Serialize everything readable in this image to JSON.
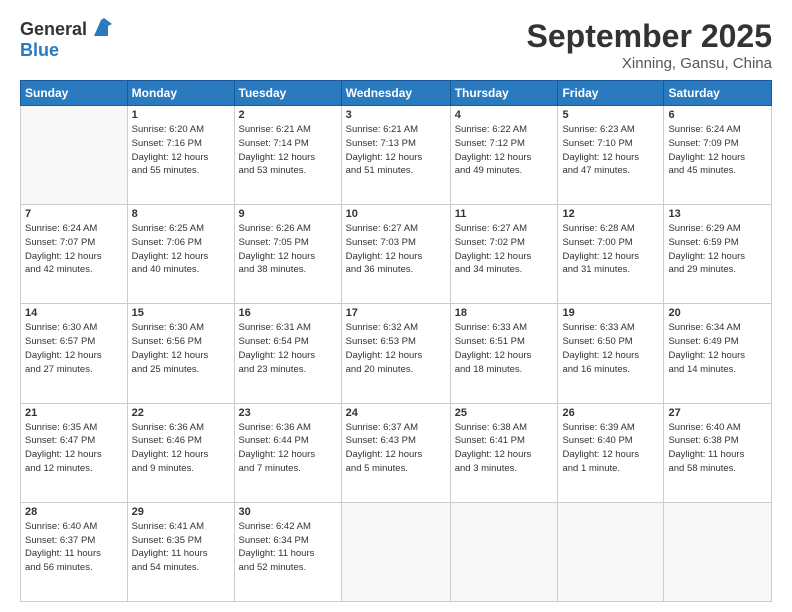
{
  "logo": {
    "general": "General",
    "blue": "Blue"
  },
  "title": "September 2025",
  "subtitle": "Xinning, Gansu, China",
  "header": {
    "days": [
      "Sunday",
      "Monday",
      "Tuesday",
      "Wednesday",
      "Thursday",
      "Friday",
      "Saturday"
    ]
  },
  "weeks": [
    [
      {
        "day": "",
        "info": ""
      },
      {
        "day": "1",
        "info": "Sunrise: 6:20 AM\nSunset: 7:16 PM\nDaylight: 12 hours\nand 55 minutes."
      },
      {
        "day": "2",
        "info": "Sunrise: 6:21 AM\nSunset: 7:14 PM\nDaylight: 12 hours\nand 53 minutes."
      },
      {
        "day": "3",
        "info": "Sunrise: 6:21 AM\nSunset: 7:13 PM\nDaylight: 12 hours\nand 51 minutes."
      },
      {
        "day": "4",
        "info": "Sunrise: 6:22 AM\nSunset: 7:12 PM\nDaylight: 12 hours\nand 49 minutes."
      },
      {
        "day": "5",
        "info": "Sunrise: 6:23 AM\nSunset: 7:10 PM\nDaylight: 12 hours\nand 47 minutes."
      },
      {
        "day": "6",
        "info": "Sunrise: 6:24 AM\nSunset: 7:09 PM\nDaylight: 12 hours\nand 45 minutes."
      }
    ],
    [
      {
        "day": "7",
        "info": "Sunrise: 6:24 AM\nSunset: 7:07 PM\nDaylight: 12 hours\nand 42 minutes."
      },
      {
        "day": "8",
        "info": "Sunrise: 6:25 AM\nSunset: 7:06 PM\nDaylight: 12 hours\nand 40 minutes."
      },
      {
        "day": "9",
        "info": "Sunrise: 6:26 AM\nSunset: 7:05 PM\nDaylight: 12 hours\nand 38 minutes."
      },
      {
        "day": "10",
        "info": "Sunrise: 6:27 AM\nSunset: 7:03 PM\nDaylight: 12 hours\nand 36 minutes."
      },
      {
        "day": "11",
        "info": "Sunrise: 6:27 AM\nSunset: 7:02 PM\nDaylight: 12 hours\nand 34 minutes."
      },
      {
        "day": "12",
        "info": "Sunrise: 6:28 AM\nSunset: 7:00 PM\nDaylight: 12 hours\nand 31 minutes."
      },
      {
        "day": "13",
        "info": "Sunrise: 6:29 AM\nSunset: 6:59 PM\nDaylight: 12 hours\nand 29 minutes."
      }
    ],
    [
      {
        "day": "14",
        "info": "Sunrise: 6:30 AM\nSunset: 6:57 PM\nDaylight: 12 hours\nand 27 minutes."
      },
      {
        "day": "15",
        "info": "Sunrise: 6:30 AM\nSunset: 6:56 PM\nDaylight: 12 hours\nand 25 minutes."
      },
      {
        "day": "16",
        "info": "Sunrise: 6:31 AM\nSunset: 6:54 PM\nDaylight: 12 hours\nand 23 minutes."
      },
      {
        "day": "17",
        "info": "Sunrise: 6:32 AM\nSunset: 6:53 PM\nDaylight: 12 hours\nand 20 minutes."
      },
      {
        "day": "18",
        "info": "Sunrise: 6:33 AM\nSunset: 6:51 PM\nDaylight: 12 hours\nand 18 minutes."
      },
      {
        "day": "19",
        "info": "Sunrise: 6:33 AM\nSunset: 6:50 PM\nDaylight: 12 hours\nand 16 minutes."
      },
      {
        "day": "20",
        "info": "Sunrise: 6:34 AM\nSunset: 6:49 PM\nDaylight: 12 hours\nand 14 minutes."
      }
    ],
    [
      {
        "day": "21",
        "info": "Sunrise: 6:35 AM\nSunset: 6:47 PM\nDaylight: 12 hours\nand 12 minutes."
      },
      {
        "day": "22",
        "info": "Sunrise: 6:36 AM\nSunset: 6:46 PM\nDaylight: 12 hours\nand 9 minutes."
      },
      {
        "day": "23",
        "info": "Sunrise: 6:36 AM\nSunset: 6:44 PM\nDaylight: 12 hours\nand 7 minutes."
      },
      {
        "day": "24",
        "info": "Sunrise: 6:37 AM\nSunset: 6:43 PM\nDaylight: 12 hours\nand 5 minutes."
      },
      {
        "day": "25",
        "info": "Sunrise: 6:38 AM\nSunset: 6:41 PM\nDaylight: 12 hours\nand 3 minutes."
      },
      {
        "day": "26",
        "info": "Sunrise: 6:39 AM\nSunset: 6:40 PM\nDaylight: 12 hours\nand 1 minute."
      },
      {
        "day": "27",
        "info": "Sunrise: 6:40 AM\nSunset: 6:38 PM\nDaylight: 11 hours\nand 58 minutes."
      }
    ],
    [
      {
        "day": "28",
        "info": "Sunrise: 6:40 AM\nSunset: 6:37 PM\nDaylight: 11 hours\nand 56 minutes."
      },
      {
        "day": "29",
        "info": "Sunrise: 6:41 AM\nSunset: 6:35 PM\nDaylight: 11 hours\nand 54 minutes."
      },
      {
        "day": "30",
        "info": "Sunrise: 6:42 AM\nSunset: 6:34 PM\nDaylight: 11 hours\nand 52 minutes."
      },
      {
        "day": "",
        "info": ""
      },
      {
        "day": "",
        "info": ""
      },
      {
        "day": "",
        "info": ""
      },
      {
        "day": "",
        "info": ""
      }
    ]
  ]
}
